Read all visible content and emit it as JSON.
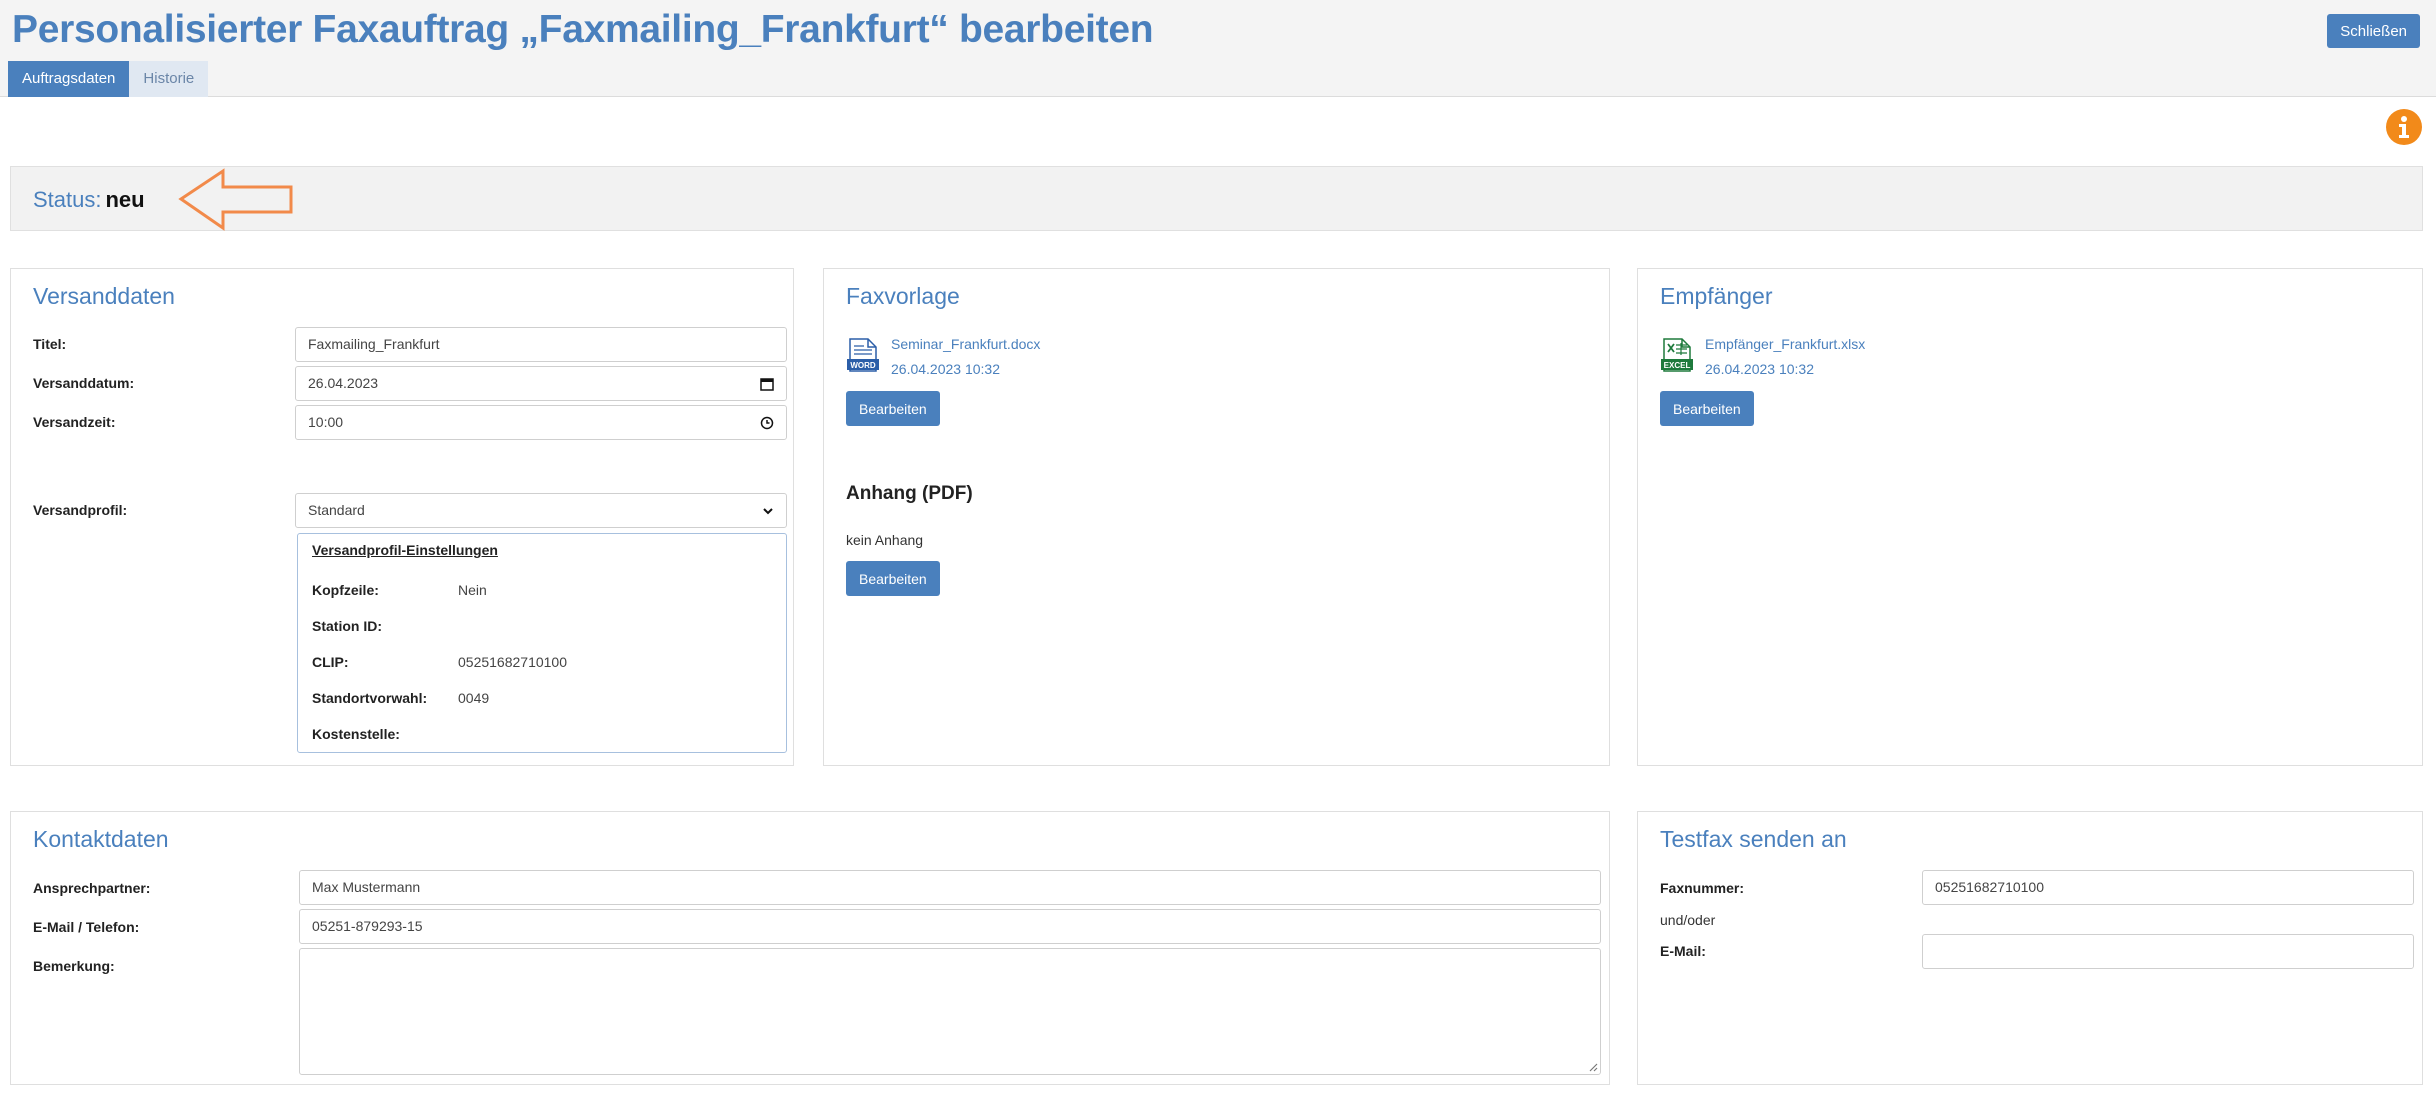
{
  "header": {
    "title": "Personalisierter Faxauftrag „Faxmailing_Frankfurt“ bearbeiten",
    "close_label": "Schließen",
    "tabs": [
      {
        "label": "Auftragsdaten",
        "active": true
      },
      {
        "label": "Historie",
        "active": false
      }
    ]
  },
  "status": {
    "label": "Status:",
    "value": "neu"
  },
  "versanddaten": {
    "title": "Versanddaten",
    "titel_label": "Titel:",
    "titel_value": "Faxmailing_Frankfurt",
    "datum_label": "Versanddatum:",
    "datum_value": "26.04.2023",
    "zeit_label": "Versandzeit:",
    "zeit_value": "10:00",
    "profil_label": "Versandprofil:",
    "profil_value": "Standard",
    "profil_settings": {
      "heading": "Versandprofil-Einstellungen",
      "rows": [
        {
          "label": "Kopfzeile:",
          "value": "Nein"
        },
        {
          "label": "Station ID:",
          "value": ""
        },
        {
          "label": "CLIP:",
          "value": "05251682710100"
        },
        {
          "label": "Standortvorwahl:",
          "value": "0049"
        },
        {
          "label": "Kostenstelle:",
          "value": ""
        }
      ]
    }
  },
  "faxvorlage": {
    "title": "Faxvorlage",
    "file_name": "Seminar_Frankfurt.docx",
    "file_date": "26.04.2023 10:32",
    "edit_label": "Bearbeiten",
    "anhang_title": "Anhang (PDF)",
    "anhang_text": "kein Anhang",
    "anhang_edit_label": "Bearbeiten"
  },
  "empfaenger": {
    "title": "Empfänger",
    "file_name": "Empfänger_Frankfurt.xlsx",
    "file_date": "26.04.2023 10:32",
    "edit_label": "Bearbeiten"
  },
  "kontaktdaten": {
    "title": "Kontaktdaten",
    "ansprech_label": "Ansprechpartner:",
    "ansprech_value": "Max Mustermann",
    "email_label": "E-Mail / Telefon:",
    "email_value": "05251-879293-15",
    "bemerkung_label": "Bemerkung:",
    "bemerkung_value": ""
  },
  "testfax": {
    "title": "Testfax senden an",
    "faxnummer_label": "Faxnummer:",
    "faxnummer_value": "05251682710100",
    "und_oder": "und/oder",
    "email_label": "E-Mail:",
    "email_value": ""
  },
  "icons": {
    "info": "info-icon",
    "arrow": "arrow-left-outline-icon",
    "word": "word-document-icon",
    "excel": "excel-document-icon",
    "calendar": "calendar-icon",
    "clock": "clock-icon",
    "chevron": "chevron-down-icon"
  },
  "colors": {
    "accent": "#4a80bd",
    "info": "#f28a1a",
    "arrow": "#f28a4a"
  }
}
